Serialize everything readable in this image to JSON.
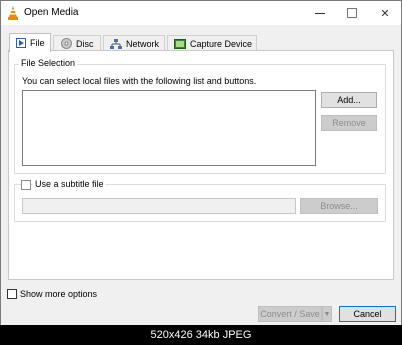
{
  "window": {
    "title": "Open Media",
    "icon": "vlc-cone-icon"
  },
  "tabs": [
    {
      "label": "File",
      "icon": "file-icon",
      "active": true
    },
    {
      "label": "Disc",
      "icon": "disc-icon",
      "active": false
    },
    {
      "label": "Network",
      "icon": "network-icon",
      "active": false
    },
    {
      "label": "Capture Device",
      "icon": "capture-device-icon",
      "active": false
    }
  ],
  "file_selection": {
    "title": "File Selection",
    "hint": "You can select local files with the following list and buttons.",
    "add_label": "Add...",
    "remove_label": "Remove"
  },
  "subtitle": {
    "checkbox_label": "Use a subtitle file",
    "checked": false,
    "browse_label": "Browse..."
  },
  "show_more_options": {
    "label": "Show more options",
    "checked": false
  },
  "actions": {
    "convert_save_label": "Convert / Save",
    "cancel_label": "Cancel"
  },
  "caption": "520x426 34kb JPEG",
  "colors": {
    "accent": "#0078d7",
    "vlc_orange": "#f08a00",
    "capture_green": "#3a8a2a"
  }
}
